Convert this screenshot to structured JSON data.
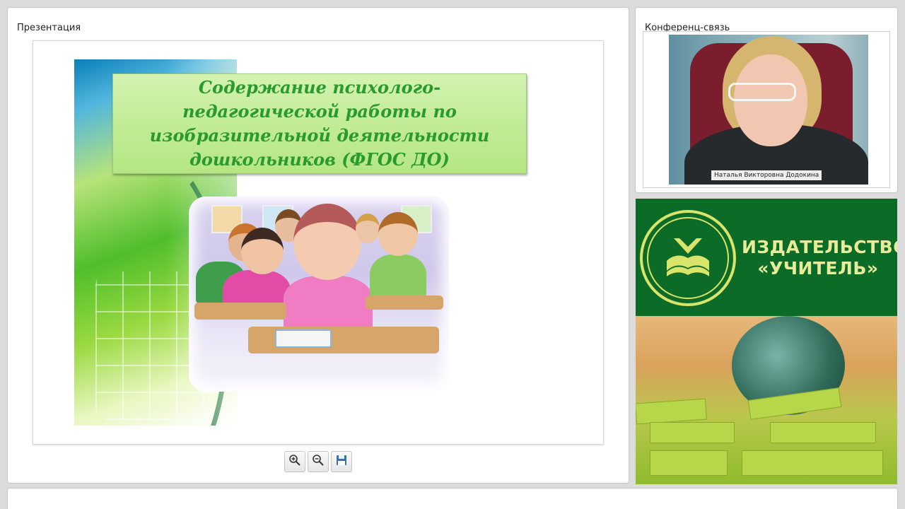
{
  "presentation_panel": {
    "title": "Презентация",
    "slide": {
      "title_lines": [
        "Содержание психолого-",
        "педагогической работы по",
        "изобразительной деятельности",
        "дошкольников (ФГОС ДО)"
      ]
    },
    "toolbar": {
      "zoom_in_icon": "zoom-in-icon",
      "zoom_out_icon": "zoom-out-icon",
      "save_icon": "save-icon"
    }
  },
  "conference_panel": {
    "title": "Конференц-связь",
    "participant_name": "Наталья Викторовна Додокина"
  },
  "publisher_banner": {
    "name_line1": "ИЗДАТЕЛЬСТВО",
    "name_line2": "«УЧИТЕЛЬ»"
  },
  "colors": {
    "slide_title": "#2a9a2e",
    "publisher_green": "#0c6b26",
    "publisher_text": "#e8ec9a"
  }
}
